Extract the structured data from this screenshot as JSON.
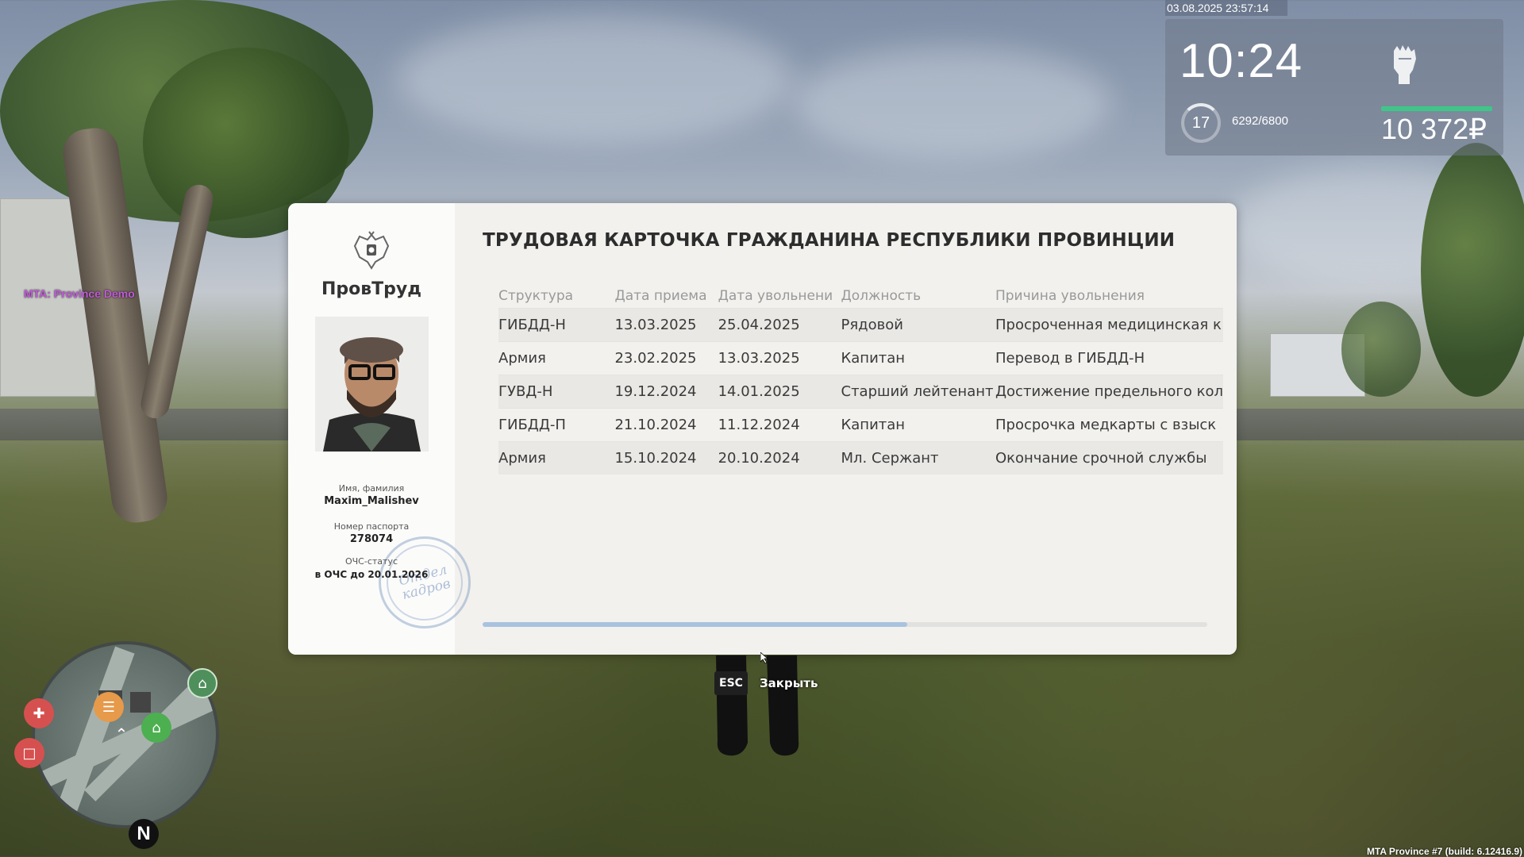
{
  "hud": {
    "datetime": "03.08.2025 23:57:14",
    "time": "10:24",
    "level": "17",
    "xp": "6292/6800",
    "money": "10 372₽",
    "health_percent": 100
  },
  "server_tag": "MTA: Province Demo",
  "build_info": "MTA Province #7 (build: 6.12416.9)",
  "card": {
    "agency_name": "ПровТруд",
    "title": "ТРУДОВАЯ КАРТОЧКА ГРАЖДАНИНА РЕСПУБЛИКИ ПРОВИНЦИИ",
    "name_label": "Имя, фамилия",
    "name_value": "Maxim_Malishev",
    "passport_label": "Номер паспорта",
    "passport_value": "278074",
    "status_label": "ОЧС-статус",
    "status_value": "в ОЧС до 20.01.2026",
    "stamp_text_line1": "Отдел",
    "stamp_text_line2": "кадров",
    "columns": [
      "Структура",
      "Дата приема",
      "Дата увольнени",
      "Должность",
      "Причина увольнения"
    ],
    "rows": [
      [
        "ГИБДД-Н",
        "13.03.2025",
        "25.04.2025",
        "Рядовой",
        "Просроченная медицинская к"
      ],
      [
        "Армия",
        "23.02.2025",
        "13.03.2025",
        "Капитан",
        "Перевод в ГИБДД-Н"
      ],
      [
        "ГУВД-Н",
        "19.12.2024",
        "14.01.2025",
        "Старший лейтенант",
        "Достижение предельного кол"
      ],
      [
        "ГИБДД-П",
        "21.10.2024",
        "11.12.2024",
        "Капитан",
        "Просрочка медкарты с взыск"
      ],
      [
        "Армия",
        "15.10.2024",
        "20.10.2024",
        "Мл. Сержант",
        "Окончание срочной службы"
      ]
    ],
    "scroll_fraction": 0.586
  },
  "close_hint": {
    "key": "ESC",
    "label": "Закрыть"
  },
  "minimap": {
    "north": "N",
    "icons": [
      "bank-icon",
      "home-icon",
      "hospital-icon",
      "shop-icon",
      "phone-icon",
      "player-arrow-icon"
    ]
  }
}
